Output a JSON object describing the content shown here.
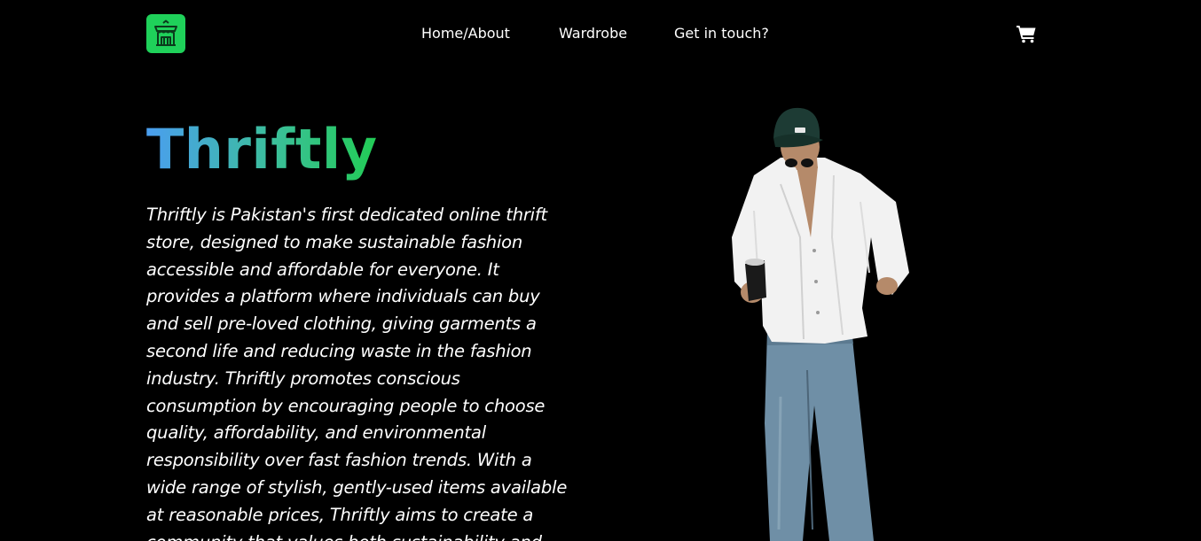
{
  "header": {
    "logo_icon": "storefront-icon",
    "nav": {
      "home_about": "Home/About",
      "wardrobe": "Wardrobe",
      "get_in_touch": "Get in touch?"
    },
    "cart_icon": "shopping-cart-icon"
  },
  "hero": {
    "title": "Thriftly",
    "description": "Thriftly is Pakistan's first dedicated online thrift store, designed to make sustainable fashion accessible and affordable for everyone. It provides a platform where individuals can buy and sell pre-loved clothing, giving garments a second life and reducing waste in the fashion industry. Thriftly promotes conscious consumption by encouraging people to choose quality, affordability, and environmental responsibility over fast fashion trends. With a wide range of stylish, gently-used items available at reasonable prices, Thriftly aims to create a community that values both sustainability and",
    "image_subject": "model-photo"
  },
  "colors": {
    "background": "#000000",
    "logo_green": "#1fd15a",
    "title_gradient_start": "#4a9ef0",
    "title_gradient_end": "#22cc55",
    "text": "#ffffff"
  }
}
